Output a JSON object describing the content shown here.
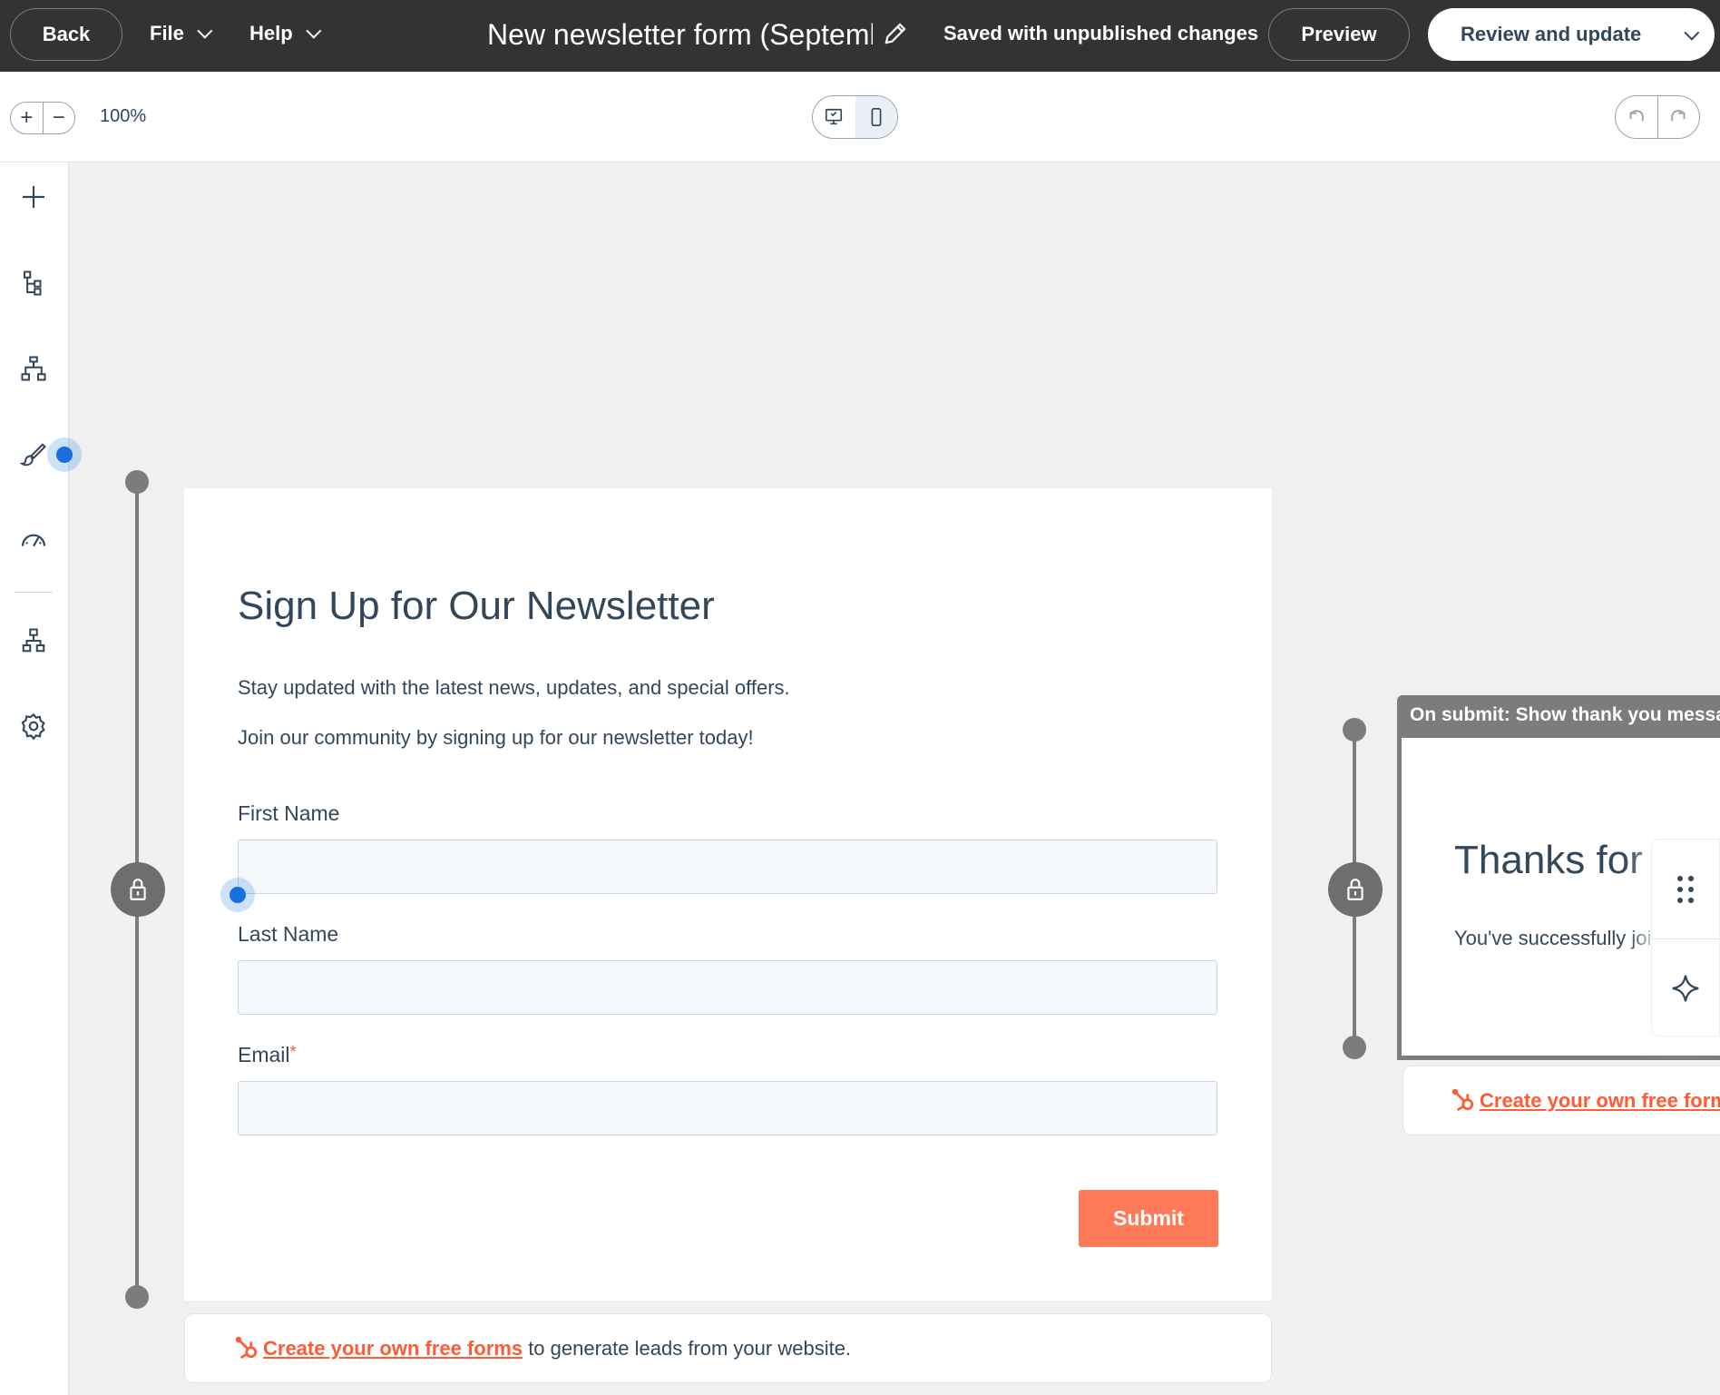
{
  "topbar": {
    "back_label": "Back",
    "file_label": "File",
    "help_label": "Help",
    "title": "New newsletter form (September",
    "save_status": "Saved with unpublished changes",
    "preview_label": "Preview",
    "review_label": "Review and update"
  },
  "toolbar": {
    "zoom_in": "+",
    "zoom_out": "−",
    "zoom_level": "100%",
    "active_device": "mobile"
  },
  "sidebar": {
    "items": [
      {
        "icon": "plus-icon"
      },
      {
        "icon": "layers-tree-icon"
      },
      {
        "icon": "hierarchy-icon"
      },
      {
        "icon": "paintbrush-icon"
      },
      {
        "icon": "speedometer-icon"
      },
      {
        "icon": "workflow-icon"
      },
      {
        "icon": "gear-icon"
      }
    ]
  },
  "form": {
    "heading": "Sign Up for Our Newsletter",
    "paragraph_1": "Stay updated with the latest news, updates, and special offers.",
    "paragraph_2": "Join our community by signing up for our newsletter today!",
    "fields": [
      {
        "label": "First Name",
        "required": false,
        "value": ""
      },
      {
        "label": "Last Name",
        "required": false,
        "value": ""
      },
      {
        "label": "Email",
        "required": true,
        "value": ""
      }
    ],
    "required_mark": "*",
    "submit_label": "Submit"
  },
  "footer": {
    "link_text": "Create your own free forms",
    "suffix": " to generate leads from your website."
  },
  "thank_you": {
    "header": "On submit: Show thank you message",
    "heading": "Thanks for Subscribing",
    "text": "You've successfully joined our newsletter.",
    "footer_link": "Create your own free forms"
  },
  "colors": {
    "topbar_bg": "#333333",
    "accent_orange": "#ff7a59",
    "link_orange": "#ff5c35",
    "text_dark": "#33475b",
    "focus_blue": "#1a6fe0"
  }
}
